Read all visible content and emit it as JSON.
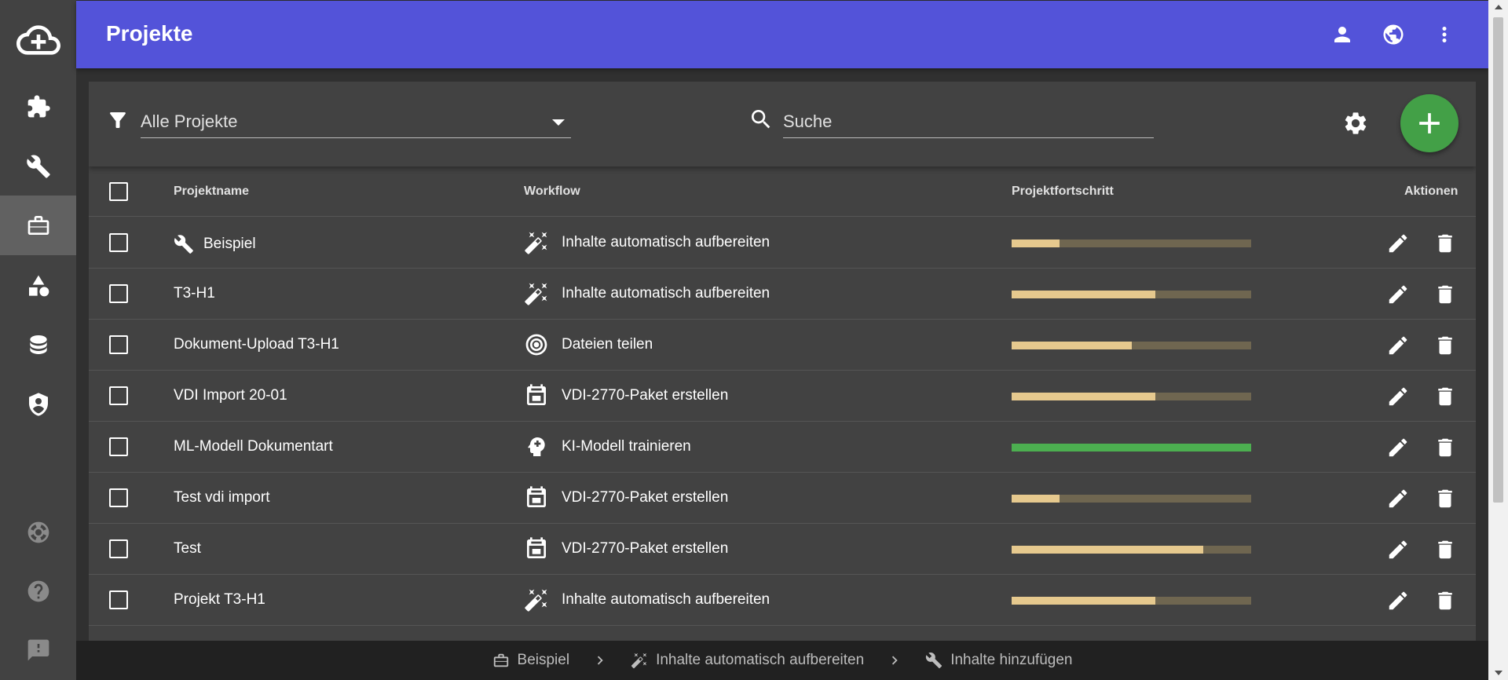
{
  "header": {
    "title": "Projekte"
  },
  "sidebar": {
    "items": [
      {
        "icon": "cloud-add-icon"
      },
      {
        "icon": "puzzle-icon"
      },
      {
        "icon": "wrench-icon"
      },
      {
        "icon": "briefcase-icon",
        "active": true
      },
      {
        "icon": "shapes-icon"
      },
      {
        "icon": "database-icon"
      },
      {
        "icon": "shield-user-icon"
      },
      {
        "icon": "lifebuoy-icon"
      },
      {
        "icon": "help-icon"
      },
      {
        "icon": "feedback-icon"
      }
    ]
  },
  "toolbar": {
    "filter_value": "Alle Projekte",
    "search_placeholder": "Suche"
  },
  "table": {
    "columns": {
      "name": "Projektname",
      "workflow": "Workflow",
      "progress": "Projektfortschritt",
      "actions": "Aktionen"
    },
    "rows": [
      {
        "name": "Beispiel",
        "name_icon": "wrench-icon",
        "workflow": "Inhalte automatisch aufbereiten",
        "workflow_icon": "magic-wand-icon",
        "progress": 0.2
      },
      {
        "name": "T3-H1",
        "workflow": "Inhalte automatisch aufbereiten",
        "workflow_icon": "magic-wand-icon",
        "progress": 0.6
      },
      {
        "name": "Dokument-Upload T3-H1",
        "workflow": "Dateien teilen",
        "workflow_icon": "target-icon",
        "progress": 0.5
      },
      {
        "name": "VDI Import 20-01",
        "workflow": "VDI-2770-Paket erstellen",
        "workflow_icon": "package-icon",
        "progress": 0.6
      },
      {
        "name": "ML-Modell Dokumentart",
        "workflow": "KI-Modell trainieren",
        "workflow_icon": "brain-icon",
        "progress": 1.0
      },
      {
        "name": "Test vdi import",
        "workflow": "VDI-2770-Paket erstellen",
        "workflow_icon": "package-icon",
        "progress": 0.2
      },
      {
        "name": "Test",
        "workflow": "VDI-2770-Paket erstellen",
        "workflow_icon": "package-icon",
        "progress": 0.8
      },
      {
        "name": "Projekt T3-H1",
        "workflow": "Inhalte automatisch aufbereiten",
        "workflow_icon": "magic-wand-icon",
        "progress": 0.6
      }
    ]
  },
  "breadcrumb": [
    {
      "label": "Beispiel",
      "icon": "briefcase-icon"
    },
    {
      "label": "Inhalte automatisch aufbereiten",
      "icon": "magic-wand-icon"
    },
    {
      "label": "Inhalte hinzufügen",
      "icon": "wrench-icon"
    }
  ],
  "colors": {
    "topbar": "#5353d9",
    "fab": "#43a047",
    "progress_fill": "#e6c98e",
    "progress_track": "#6f6650",
    "progress_done": "#4caf50"
  }
}
